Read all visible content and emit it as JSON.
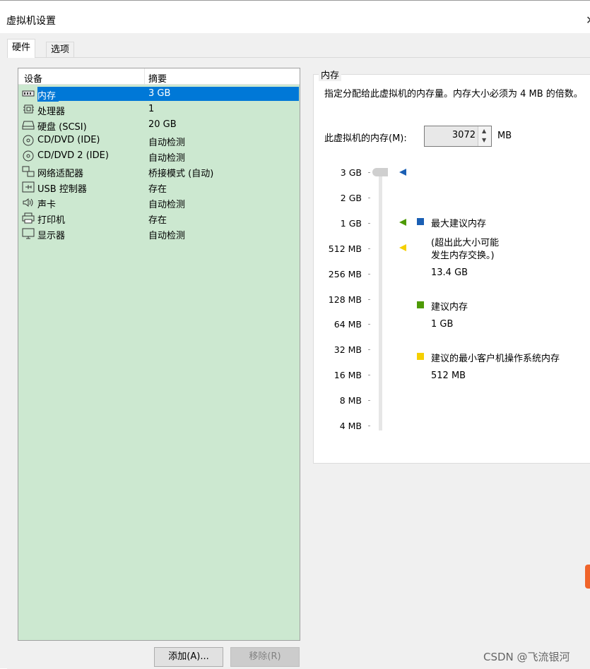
{
  "window": {
    "title": "虚拟机设置"
  },
  "tabs": [
    {
      "label": "硬件",
      "active": true
    },
    {
      "label": "选项",
      "active": false
    }
  ],
  "device_list": {
    "columns": [
      "设备",
      "摘要"
    ],
    "rows": [
      {
        "name": "内存",
        "summary": "3 GB",
        "icon": "memory-icon",
        "selected": true
      },
      {
        "name": "处理器",
        "summary": "1",
        "icon": "processor-icon"
      },
      {
        "name": "硬盘 (SCSI)",
        "summary": "20 GB",
        "icon": "hard-disk-icon"
      },
      {
        "name": "CD/DVD (IDE)",
        "summary": "自动检测",
        "icon": "cd-dvd-icon"
      },
      {
        "name": "CD/DVD 2 (IDE)",
        "summary": "自动检测",
        "icon": "cd-dvd-icon"
      },
      {
        "name": "网络适配器",
        "summary": "桥接模式 (自动)",
        "icon": "network-adapter-icon"
      },
      {
        "name": "USB 控制器",
        "summary": "存在",
        "icon": "usb-icon"
      },
      {
        "name": "声卡",
        "summary": "自动检测",
        "icon": "speaker-icon"
      },
      {
        "name": "打印机",
        "summary": "存在",
        "icon": "printer-icon"
      },
      {
        "name": "显示器",
        "summary": "自动检测",
        "icon": "monitor-icon"
      }
    ]
  },
  "buttons": {
    "add": "添加(A)...",
    "remove": "移除(R)"
  },
  "memory": {
    "group_title": "内存",
    "description": "指定分配给此虚拟机的内存量。内存大小必须为 4 MB 的倍数。",
    "field_label": "此虚拟机的内存(M):",
    "value": "3072",
    "unit": "MB",
    "ticks": [
      "3 GB",
      "2 GB",
      "1 GB",
      "512 MB",
      "256 MB",
      "128 MB",
      "64 MB",
      "32 MB",
      "16 MB",
      "8 MB",
      "4 MB"
    ],
    "legend": {
      "max": {
        "label": "最大建议内存",
        "note_line1": "(超出此大小可能",
        "note_line2": "发生内存交换。)",
        "value": "13.4 GB",
        "color": "#1a5fb4"
      },
      "recommended": {
        "label": "建议内存",
        "value": "1 GB",
        "color": "#4e9a06"
      },
      "min": {
        "label": "建议的最小客户机操作系统内存",
        "value": "512 MB",
        "color": "#f5d000"
      }
    }
  },
  "watermark": "CSDN @飞流银河"
}
